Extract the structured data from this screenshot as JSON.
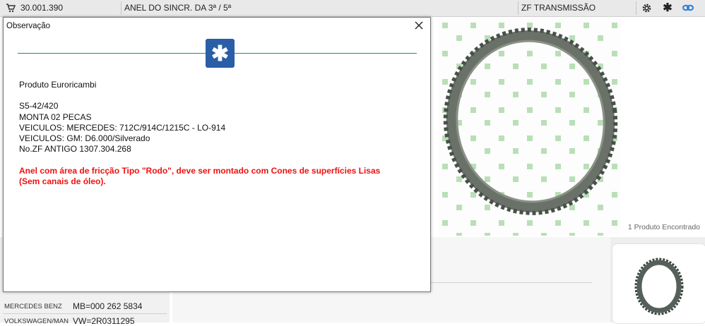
{
  "topbar": {
    "code": "30.001.390",
    "description": "ANEL DO SINCR. DA 3ª / 5ª",
    "brand": "ZF TRANSMISSÃO"
  },
  "background": {
    "found_text": "1 Produto Encontrado",
    "rows": [
      {
        "maker": "MERCEDES BENZ",
        "code": "MB=000 262 5834"
      },
      {
        "maker": "VOLKSWAGEN/MAN",
        "code": "VW=2R0311295"
      }
    ]
  },
  "modal": {
    "title": "Observação",
    "lines": [
      "Produto Euroricambi",
      "",
      "S5-42/420",
      "MONTA 02 PECAS",
      "VEICULOS: MERCEDES: 712C/914C/1215C - LO-914",
      "VEICULOS: GM: D6.000/Silverado",
      "No.ZF ANTIGO 1307.304.268"
    ],
    "warning": "Anel com área de fricção Tipo \"Rodo\", deve ser montado com Cones de superfícies Lisas (Sem canais de óleo).",
    "accent_color": "#2a5ea7",
    "line_color": "#1d8a7a",
    "warning_color": "#ee1111"
  }
}
